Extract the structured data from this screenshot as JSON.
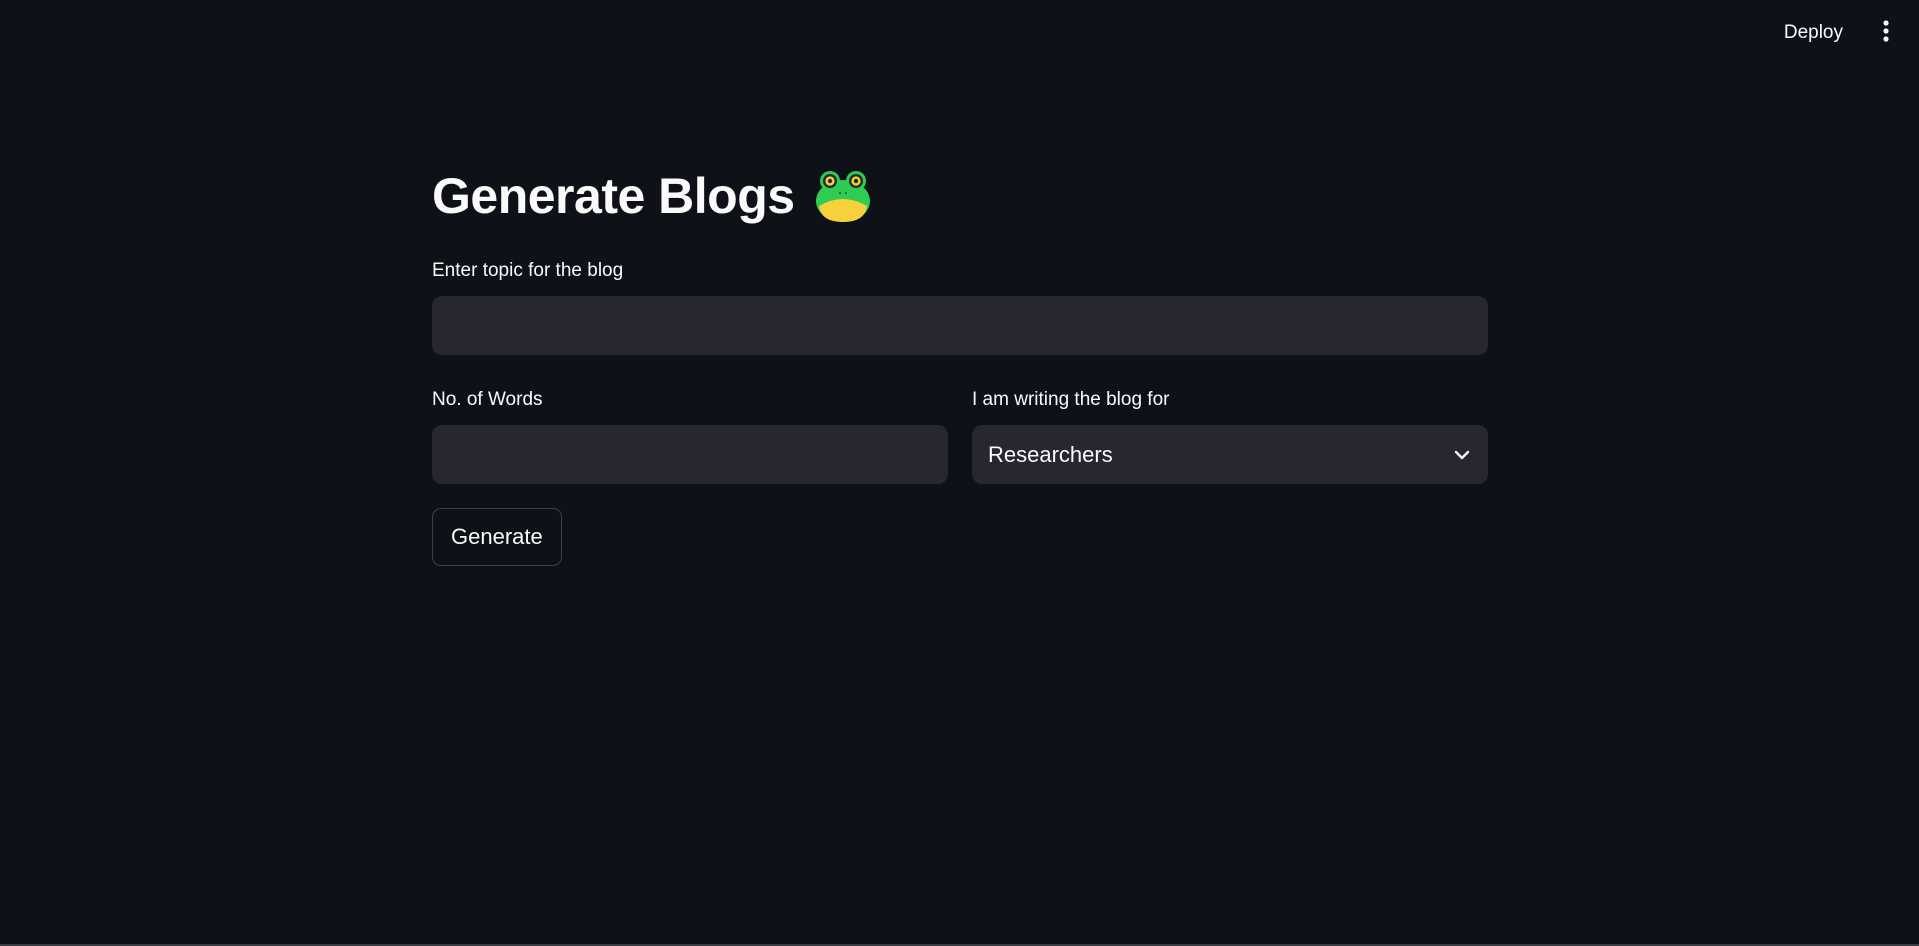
{
  "toolbar": {
    "deploy_label": "Deploy",
    "menu_icon": "more-vertical-icon"
  },
  "main": {
    "title": "Generate Blogs",
    "title_icon": "frog-icon",
    "topic_field": {
      "label": "Enter topic for the blog",
      "value": "",
      "placeholder": ""
    },
    "words_field": {
      "label": "No. of Words",
      "value": "",
      "placeholder": ""
    },
    "audience_select": {
      "label": "I am writing the blog for",
      "selected": "Researchers"
    },
    "generate_label": "Generate"
  },
  "colors": {
    "background": "#0e1117",
    "input_background": "#262730",
    "text": "#fafafa",
    "button_border": "#3d404a"
  }
}
